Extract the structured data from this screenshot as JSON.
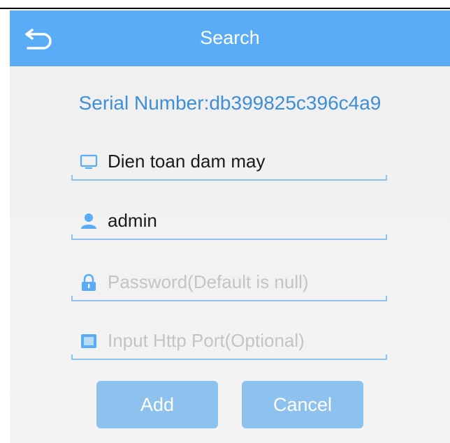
{
  "header": {
    "title": "Search",
    "back_icon": "back-arrow-icon",
    "background_color": "#5aacf6"
  },
  "serial": {
    "text": "Serial Number:db399825c396c4a9",
    "color": "#3f8fd6"
  },
  "form": {
    "device_name": {
      "value": "Dien toan dam may",
      "icon": "monitor-icon"
    },
    "username": {
      "value": "admin",
      "icon": "user-icon"
    },
    "password": {
      "value": "",
      "placeholder": "Password(Default is null)",
      "icon": "lock-icon"
    },
    "http_port": {
      "value": "",
      "placeholder": "Input Http Port(Optional)",
      "icon": "port-icon"
    }
  },
  "buttons": {
    "add_label": "Add",
    "cancel_label": "Cancel",
    "color": "#8ec2ee"
  }
}
